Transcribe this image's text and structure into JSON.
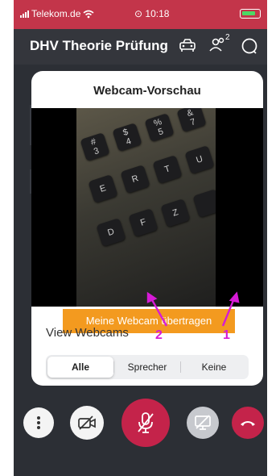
{
  "status_bar": {
    "carrier": "Telekom.de",
    "time": "10:18"
  },
  "header": {
    "title": "DHV Theorie Prüfung",
    "participants_count": "2"
  },
  "dialog": {
    "title": "Webcam-Vorschau",
    "share_button": "Meine Webcam übertragen",
    "view_label": "View Webcams",
    "segments": [
      "Alle",
      "Sprecher",
      "Keine"
    ],
    "active_segment": "Alle"
  },
  "annotations": {
    "label_1": "1",
    "label_2": "2"
  },
  "keyboard_keys": [
    {
      "label": "#\n3"
    },
    {
      "label": "$\n4"
    },
    {
      "label": "%\n5"
    },
    {
      "label": "&\n7"
    },
    {
      "label": "E"
    },
    {
      "label": "R"
    },
    {
      "label": "T"
    },
    {
      "label": "U"
    },
    {
      "label": "D"
    },
    {
      "label": "F"
    },
    {
      "label": "Z"
    },
    {
      "label": ""
    }
  ],
  "colors": {
    "status_bar": "#c3354a",
    "accent_orange": "#f39a1f",
    "mic_button": "#c4234a",
    "hangup_button": "#c4234a",
    "annotation": "#d61ad6"
  },
  "icons": {
    "toolbar": [
      "more-options-icon",
      "camera-off-icon",
      "mic-muted-icon",
      "screenshare-off-icon",
      "hangup-icon"
    ]
  }
}
